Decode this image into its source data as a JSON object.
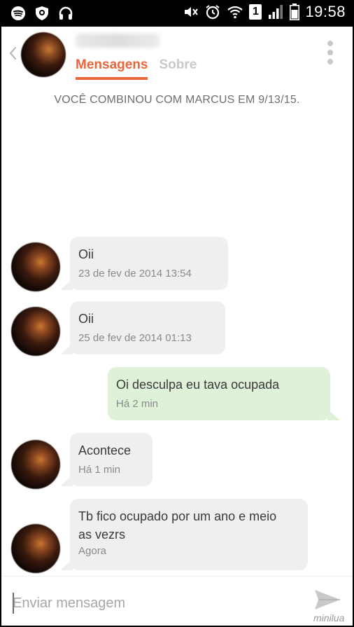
{
  "status_bar": {
    "time": "19:58",
    "sim_slot": "1",
    "left_icons": [
      "spotify-icon",
      "shield-icon",
      "headphones-icon"
    ],
    "right_icons": [
      "mute-icon",
      "alarm-icon",
      "wifi-icon",
      "sim-icon",
      "signal-icon",
      "battery-icon"
    ]
  },
  "header": {
    "tabs": [
      {
        "label": "Mensagens",
        "active": true
      },
      {
        "label": "Sobre",
        "active": false
      }
    ],
    "accent_color": "#e8673c"
  },
  "match_notice": "VOCÊ COMBINOU COM MARCUS EM 9/13/15.",
  "messages": [
    {
      "direction": "in",
      "text": "Oii",
      "time": "23 de fev de 2014  13:54"
    },
    {
      "direction": "in",
      "text": "Oii",
      "time": "25 de fev de 2014  01:13"
    },
    {
      "direction": "out",
      "text": "Oi desculpa eu tava ocupada",
      "time": "Há 2 min"
    },
    {
      "direction": "in",
      "text": "Acontece",
      "time": "Há 1 min"
    },
    {
      "direction": "in",
      "text": "Tb fico ocupado por um ano e meio as vezrs",
      "time": "Agora"
    }
  ],
  "composer": {
    "placeholder": "Enviar mensagem",
    "send_icon": "send-icon"
  },
  "watermark": "minilua",
  "colors": {
    "incoming_bubble": "#efefef",
    "outgoing_bubble": "#dff2d9"
  }
}
